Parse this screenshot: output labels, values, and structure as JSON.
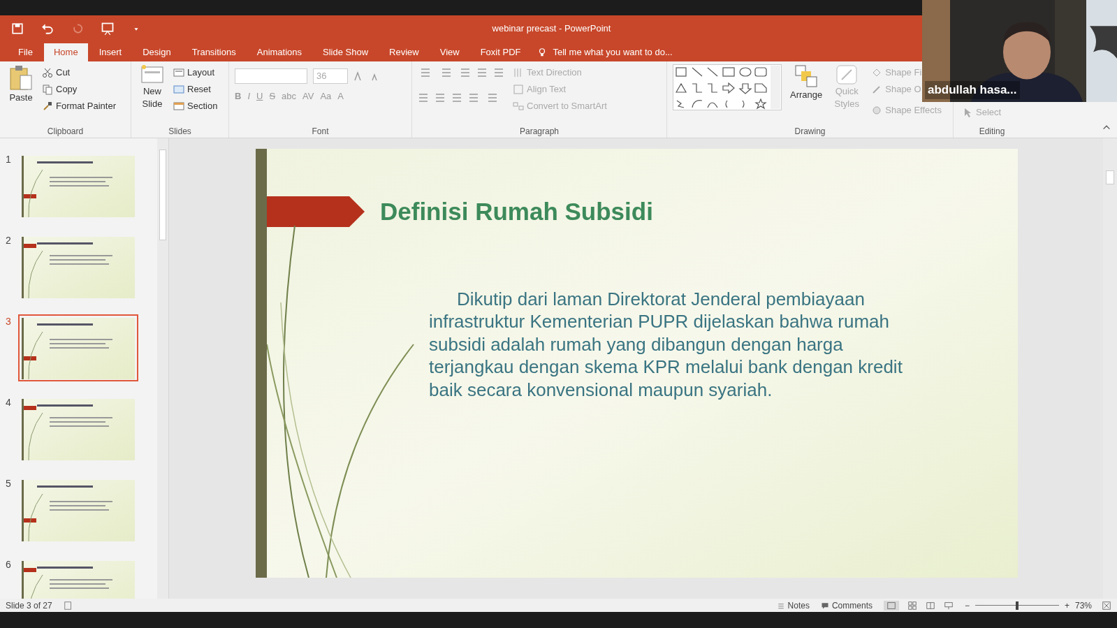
{
  "window": {
    "title": "webinar precast - PowerPoint"
  },
  "tabs": [
    {
      "label": "File",
      "selected": false
    },
    {
      "label": "Home",
      "selected": true
    },
    {
      "label": "Insert",
      "selected": false
    },
    {
      "label": "Design",
      "selected": false
    },
    {
      "label": "Transitions",
      "selected": false
    },
    {
      "label": "Animations",
      "selected": false
    },
    {
      "label": "Slide Show",
      "selected": false
    },
    {
      "label": "Review",
      "selected": false
    },
    {
      "label": "View",
      "selected": false
    },
    {
      "label": "Foxit PDF",
      "selected": false
    }
  ],
  "tell_me": {
    "placeholder": "Tell me what you want to do..."
  },
  "ribbon": {
    "clipboard": {
      "label": "Clipboard",
      "paste": "Paste",
      "cut": "Cut",
      "copy": "Copy",
      "format_painter": "Format Painter"
    },
    "slides": {
      "label": "Slides",
      "new_slide": "New Slide",
      "layout": "Layout",
      "reset": "Reset",
      "section": "Section"
    },
    "font": {
      "label": "Font",
      "size": "36",
      "buttons": [
        "B",
        "I",
        "U",
        "S",
        "abc",
        "AV",
        "Aa",
        "A"
      ]
    },
    "paragraph": {
      "label": "Paragraph",
      "text_direction": "Text Direction",
      "align_text": "Align Text",
      "convert": "Convert to SmartArt"
    },
    "drawing": {
      "label": "Drawing",
      "arrange": "Arrange",
      "quick_styles": "Quick Styles",
      "shape_fill": "Shape Fi",
      "shape_outline": "Shape O",
      "shape_effects": "Shape Effects"
    },
    "editing": {
      "label": "Editing",
      "select": "Select"
    }
  },
  "thumbnails": [
    {
      "number": "1",
      "selected": false
    },
    {
      "number": "2",
      "selected": false
    },
    {
      "number": "3",
      "selected": true
    },
    {
      "number": "4",
      "selected": false
    },
    {
      "number": "5",
      "selected": false
    },
    {
      "number": "6",
      "selected": false
    }
  ],
  "slide": {
    "title": "Definisi Rumah Subsidi",
    "body": "Dikutip dari laman Direktorat Jenderal pembiayaan infrastruktur Kementerian PUPR dijelaskan bahwa rumah subsidi adalah rumah yang dibangun dengan harga terjangkau dengan skema KPR melalui bank dengan kredit baik secara konvensional maupun syariah."
  },
  "status_bar": {
    "slide_info": "Slide 3 of 27",
    "notes": "Notes",
    "comments": "Comments",
    "zoom_out": "−",
    "zoom_in": "+",
    "zoom_level": "73%",
    "zoom_slider": {
      "level": 0.5
    }
  },
  "video": {
    "participant": "abdullah hasa..."
  }
}
